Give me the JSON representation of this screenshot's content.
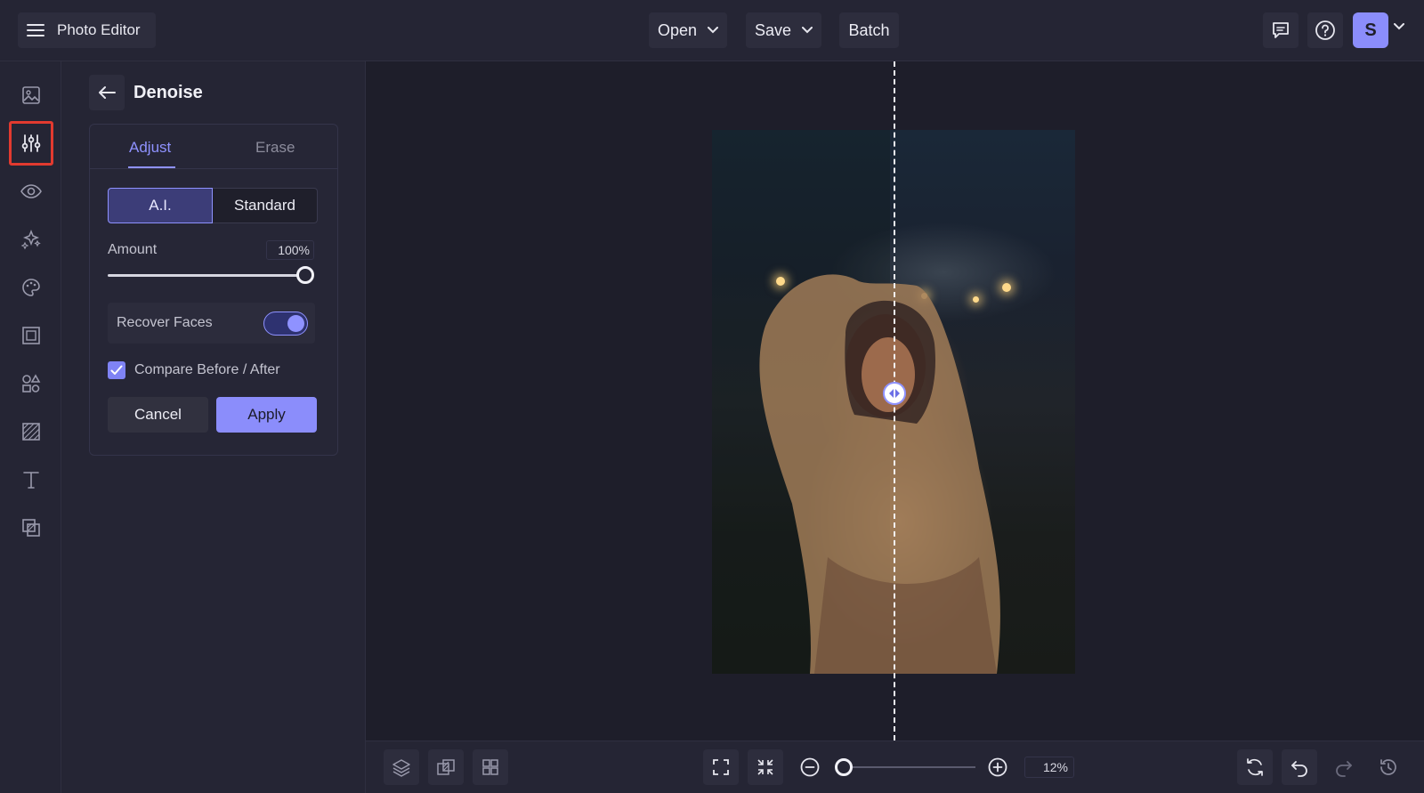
{
  "app": {
    "title": "Photo Editor"
  },
  "header": {
    "open_label": "Open",
    "save_label": "Save",
    "batch_label": "Batch",
    "avatar_initial": "S"
  },
  "rail": {
    "items": [
      {
        "icon": "image-icon"
      },
      {
        "icon": "adjustments-icon",
        "active": true
      },
      {
        "icon": "eye-icon"
      },
      {
        "icon": "sparkles-icon"
      },
      {
        "icon": "palette-icon"
      },
      {
        "icon": "frame-icon"
      },
      {
        "icon": "shapes-icon"
      },
      {
        "icon": "texture-icon"
      },
      {
        "icon": "text-icon"
      },
      {
        "icon": "overlay-icon"
      }
    ]
  },
  "panel": {
    "title": "Denoise",
    "tabs": [
      {
        "label": "Adjust",
        "active": true
      },
      {
        "label": "Erase"
      }
    ],
    "modes": [
      {
        "label": "A.I.",
        "selected": true
      },
      {
        "label": "Standard"
      }
    ],
    "amount_label": "Amount",
    "amount_value": "100%",
    "amount": 1.0,
    "recover_faces_label": "Recover Faces",
    "recover_faces_on": true,
    "compare_label": "Compare Before / After",
    "compare_checked": true,
    "cancel_label": "Cancel",
    "apply_label": "Apply"
  },
  "bottom": {
    "zoom_value": "12%"
  },
  "colors": {
    "accent": "#8b8dfb",
    "background": "#1e1e2a",
    "panel": "#252534",
    "active_highlight": "#e23a2f"
  }
}
